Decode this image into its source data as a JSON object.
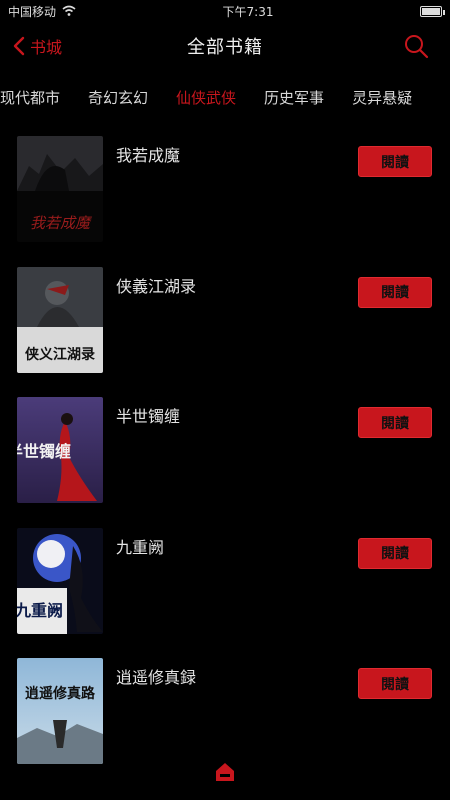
{
  "status_bar": {
    "carrier": "中国移动",
    "time": "下午7:31"
  },
  "header": {
    "back_label": "书城",
    "title": "全部书籍"
  },
  "category_tabs": [
    {
      "label": "现代都市",
      "active": false
    },
    {
      "label": "奇幻玄幻",
      "active": false
    },
    {
      "label": "仙侠武侠",
      "active": true
    },
    {
      "label": "历史军事",
      "active": false
    },
    {
      "label": "灵异悬疑",
      "active": false
    }
  ],
  "books": [
    {
      "title": "我若成魔",
      "action": "閱讀",
      "cover_text": "我若成魔",
      "cover_theme": "dark"
    },
    {
      "title": "侠義江湖录",
      "action": "閱讀",
      "cover_text": "侠义江湖录",
      "cover_theme": "warrior"
    },
    {
      "title": "半世镯缠",
      "action": "閱讀",
      "cover_text": "半世镯缠",
      "cover_theme": "purple"
    },
    {
      "title": "九重阙",
      "action": "閱讀",
      "cover_text": "九重阙",
      "cover_theme": "moon"
    },
    {
      "title": "逍遥修真録",
      "action": "閱讀",
      "cover_text": "逍遥修真路",
      "cover_theme": "sky"
    }
  ],
  "colors": {
    "accent": "#c8161d",
    "background": "#000000",
    "text": "#e4e4e4"
  },
  "icons": {
    "back": "chevron-left-icon",
    "search": "search-icon",
    "home": "home-icon",
    "wifi": "wifi-icon",
    "battery": "battery-icon"
  }
}
